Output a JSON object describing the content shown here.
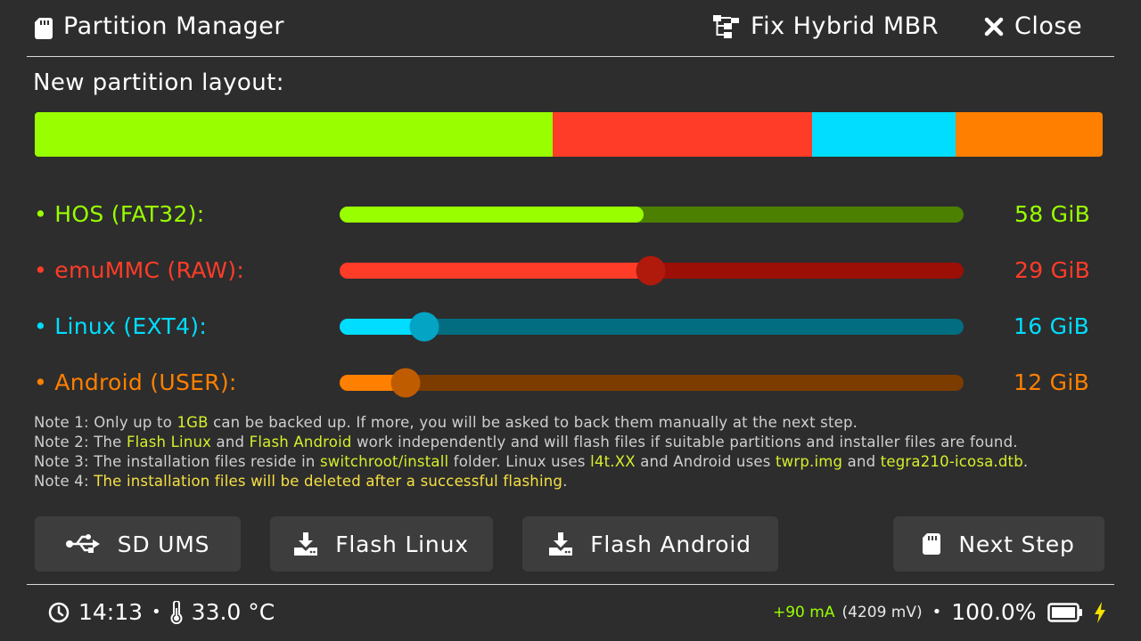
{
  "header": {
    "title": "Partition Manager",
    "fix_mbr_label": "Fix Hybrid MBR",
    "close_label": "Close"
  },
  "layout_title": "New partition layout:",
  "partition_bar": {
    "segments": [
      {
        "name": "HOS",
        "fraction": 0.485,
        "color": "#99ff00"
      },
      {
        "name": "emuMMC",
        "fraction": 0.243,
        "color": "#ff3c28"
      },
      {
        "name": "Linux",
        "fraction": 0.134,
        "color": "#00ddff"
      },
      {
        "name": "Android",
        "fraction": 0.138,
        "color": "#ff8000"
      }
    ]
  },
  "partitions": [
    {
      "label": "• HOS (FAT32):",
      "value": "58 GiB",
      "level": 0.487,
      "color": "#99ff00",
      "track": "#4c8000",
      "knob": null
    },
    {
      "label": "• emuMMC (RAW):",
      "value": "29 GiB",
      "level": 0.499,
      "color": "#ff3c28",
      "track": "#9c0f06",
      "knob": "#b01a0c"
    },
    {
      "label": "• Linux (EXT4):",
      "value": "16 GiB",
      "level": 0.135,
      "color": "#00ddff",
      "track": "#026c80",
      "knob": "#04a4c4"
    },
    {
      "label": "• Android (USER):",
      "value": "12 GiB",
      "level": 0.105,
      "color": "#ff8000",
      "track": "#7c3c00",
      "knob": "#c05c00"
    }
  ],
  "notes": {
    "n1": {
      "a": "Note 1: Only up to ",
      "b": "1GB",
      "c": " can be backed up. If more, you will be asked to back them manually at the next step."
    },
    "n2": {
      "a": "Note 2: The ",
      "b": "Flash Linux",
      "c": " and ",
      "d": "Flash Android",
      "e": " work independently and will flash files if suitable partitions and installer files are found."
    },
    "n3": {
      "a": "Note 3: The installation files reside in ",
      "b": "switchroot/install",
      "c": " folder. Linux uses ",
      "d": "l4t.XX",
      "e": " and Android uses ",
      "f": "twrp.img",
      "g": " and ",
      "h": "tegra210-icosa.dtb",
      "i": "."
    },
    "n4": {
      "a": "Note 4: ",
      "b": "The installation files will be deleted after a successful flashing",
      "c": "."
    }
  },
  "buttons": {
    "sd_ums": "SD UMS",
    "flash_linux": "Flash Linux",
    "flash_android": "Flash Android",
    "next_step": "Next Step"
  },
  "footer": {
    "time": "14:13",
    "sep": "•",
    "temp": "33.0 °C",
    "current": "+90 mA",
    "voltage": "(4209 mV)",
    "battery_pct": "100.0%",
    "battery_level": 1.0
  },
  "icons": [
    "sd-card-icon",
    "tree-icon",
    "close-icon",
    "usb-icon",
    "download-icon",
    "clock-icon",
    "thermometer-icon",
    "battery-icon",
    "charging-bolt-icon"
  ]
}
